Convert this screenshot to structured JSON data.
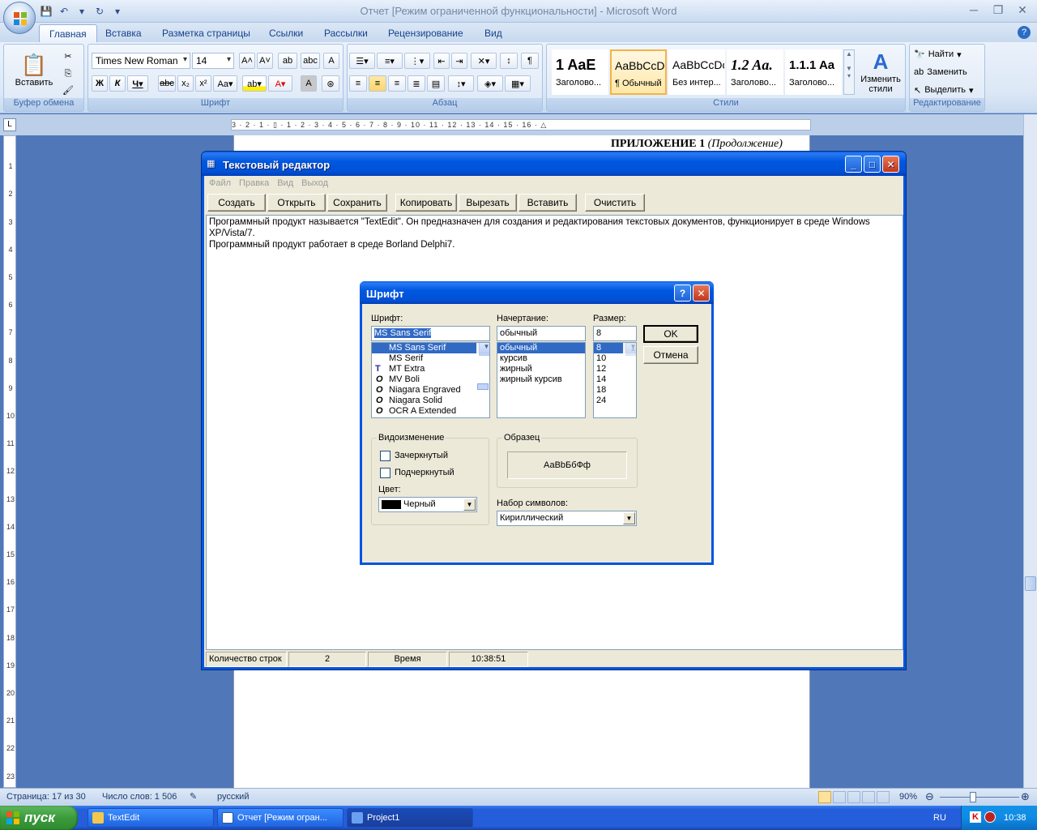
{
  "word": {
    "title": "Отчет [Режим ограниченной функциональности] - Microsoft Word",
    "tabs": [
      "Главная",
      "Вставка",
      "Разметка страницы",
      "Ссылки",
      "Рассылки",
      "Рецензирование",
      "Вид"
    ],
    "clipboard": {
      "paste": "Вставить",
      "label": "Буфер обмена"
    },
    "font": {
      "name": "Times New Roman",
      "size": "14",
      "label": "Шрифт"
    },
    "paragraph_label": "Абзац",
    "styles": {
      "items": [
        {
          "preview": "1 AaE",
          "label": "Заголово..."
        },
        {
          "preview": "AaBbCcDc",
          "label": "¶ Обычный"
        },
        {
          "preview": "AaBbCcDc",
          "label": "Без интер..."
        },
        {
          "preview": "1.2 Aa.",
          "label": "Заголово..."
        },
        {
          "preview": "1.1.1 Aa",
          "label": "Заголово..."
        }
      ],
      "change": "Изменить стили",
      "label": "Стили"
    },
    "editing": {
      "find": "Найти",
      "replace": "Заменить",
      "select": "Выделить",
      "label": "Редактирование"
    },
    "page_header_bold": "ПРИЛОЖЕНИЕ 1",
    "page_header_italic": "(Продолжение)",
    "status": {
      "page": "Страница: 17 из 30",
      "words": "Число слов: 1 506",
      "lang": "русский",
      "zoom": "90%"
    },
    "ruler_ticks": "3 · 2 · 1 · ▯ · 1 · 2 · 3 · 4 · 5 · 6 · 7 · 8 · 9 · 10 · 11 · 12 · 13 · 14 · 15 · 16 · △"
  },
  "textedit": {
    "title": "Текстовый редактор",
    "menu": [
      "Файл",
      "Правка",
      "Вид",
      "Выход"
    ],
    "toolbar": [
      "Создать",
      "Открыть",
      "Сохранить",
      "Копировать",
      "Вырезать",
      "Вставить",
      "Очистить"
    ],
    "memo_line1": "Программный продукт называется \"TextEdit\". Он предназначен для создания и редактирования текстовых документов, функционирует в среде Windows XP/Vista/7.",
    "memo_line2": "Программный продукт работает в среде Borland Delphi7.",
    "status": {
      "lines_label": "Количество строк",
      "lines_value": "2",
      "time_label": "Время",
      "time_value": "10:38:51"
    }
  },
  "font_dialog": {
    "title": "Шрифт",
    "font_label": "Шрифт:",
    "font_value": "MS Sans Serif",
    "fonts": [
      "MS Sans Serif",
      "MS Serif",
      "MT Extra",
      "MV Boli",
      "Niagara Engraved",
      "Niagara Solid",
      "OCR A Extended"
    ],
    "style_label": "Начертание:",
    "style_value": "обычный",
    "styles": [
      "обычный",
      "курсив",
      "жирный",
      "жирный курсив"
    ],
    "size_label": "Размер:",
    "size_value": "8",
    "sizes": [
      "8",
      "10",
      "12",
      "14",
      "18",
      "24"
    ],
    "ok": "OK",
    "cancel": "Отмена",
    "effects_label": "Видоизменение",
    "strike": "Зачеркнутый",
    "underline": "Подчеркнутый",
    "color_label": "Цвет:",
    "color_value": "Черный",
    "sample_label": "Образец",
    "sample_text": "АаВbБбФф",
    "charset_label": "Набор символов:",
    "charset_value": "Кириллический"
  },
  "taskbar": {
    "start": "пуск",
    "tasks": [
      "TextEdit",
      "Отчет [Режим огран...",
      "Project1"
    ],
    "lang": "RU",
    "clock": "10:38"
  }
}
